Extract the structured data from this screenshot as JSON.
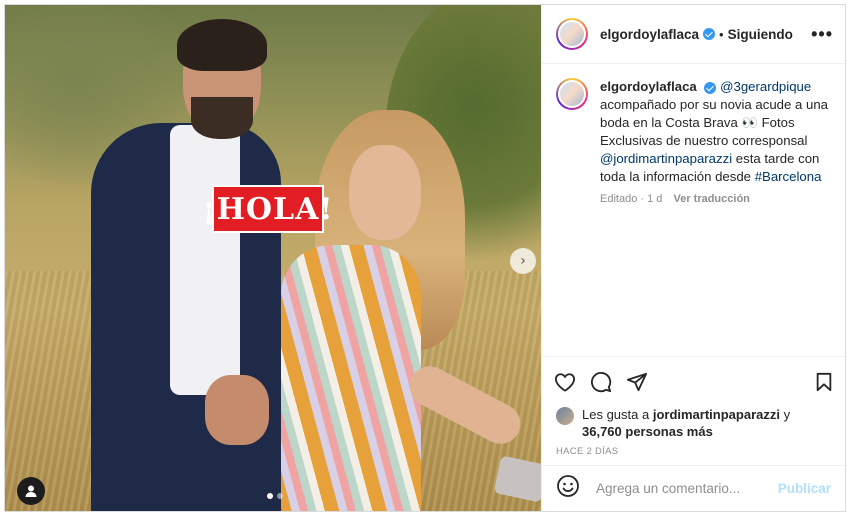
{
  "photo": {
    "overlay_logo_text": "¡HOLA!",
    "next_icon": "chevron-right-icon",
    "carousel": {
      "total": 2,
      "active": 1
    },
    "tag_icon": "user-icon"
  },
  "header": {
    "username": "elgordoylaflaca",
    "separator": "•",
    "follow_label": "Siguiendo",
    "more_icon": "ellipsis-icon",
    "more_label": "•••"
  },
  "caption": {
    "username": "elgordoylaflaca",
    "mention1": "@3gerardpique",
    "text1": " acompañado por su novia acude a una boda en la Costa Brava 👀 Fotos Exclusivas de nuestro corresponsal ",
    "mention2": "@jordimartinpaparazzi",
    "text2": " esta tarde con toda la información desde ",
    "hashtag": "#Barcelona",
    "edited": "Editado",
    "dot": "·",
    "age": "1 d",
    "translate": "Ver traducción"
  },
  "actions": {
    "like_icon": "heart-icon",
    "comment_icon": "comment-icon",
    "share_icon": "share-icon",
    "save_icon": "bookmark-icon"
  },
  "likes": {
    "prefix": "Les gusta a ",
    "user": "jordimartinpaparazzi",
    "middle": " y ",
    "count": "36,760 personas más"
  },
  "timestamp": "HACE 2 DÍAS",
  "comment": {
    "placeholder": "Agrega un comentario...",
    "publish_label": "Publicar",
    "emoji_icon": "smiley-icon"
  },
  "colors": {
    "accent_link": "#00376b",
    "verified": "#3897f0",
    "publish_disabled": "#b2dffc",
    "hola_red": "#e21d23"
  }
}
